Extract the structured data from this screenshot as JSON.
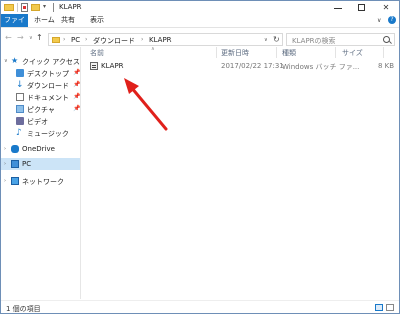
{
  "window": {
    "title": "KLAPR",
    "controls": {
      "minimize": "—",
      "maximize": "□",
      "close": "✕"
    }
  },
  "ribbon": {
    "tabs": [
      {
        "label": "ファイル"
      },
      {
        "label": "ホーム"
      },
      {
        "label": "共有"
      },
      {
        "label": "表示"
      }
    ],
    "chevron": "∨",
    "help": "?"
  },
  "address": {
    "back": "←",
    "forward": "→",
    "history_dropdown": "∨",
    "up": "↑",
    "breadcrumbs": [
      "PC",
      "ダウンロード",
      "KLAPR"
    ],
    "separator": "›",
    "dropdown": "∨",
    "refresh": "↻"
  },
  "search": {
    "placeholder": "KLAPRの検索"
  },
  "nav": {
    "quick_access": "クイック アクセス",
    "items": [
      {
        "label": "デスクトップ",
        "pin": "📌"
      },
      {
        "label": "ダウンロード",
        "pin": "📌"
      },
      {
        "label": "ドキュメント",
        "pin": "📌"
      },
      {
        "label": "ピクチャ",
        "pin": "📌"
      },
      {
        "label": "ビデオ"
      },
      {
        "label": "ミュージック"
      }
    ],
    "onedrive": "OneDrive",
    "pc": "PC",
    "network": "ネットワーク",
    "expander": "›",
    "expanded": "∨"
  },
  "columns": {
    "name": "名前",
    "modified": "更新日時",
    "type": "種類",
    "size": "サイズ",
    "sort_caret": "∧"
  },
  "files": [
    {
      "name": "KLAPR",
      "modified": "2017/02/22 17:31",
      "type": "Windows バッチ ファ...",
      "size": "8 KB",
      "icon": "batch-file-icon"
    }
  ],
  "status": {
    "text": "1 個の項目"
  },
  "colors": {
    "accent": "#1979ca",
    "annotation_arrow": "#e0201b",
    "selection": "#cce4f7"
  }
}
